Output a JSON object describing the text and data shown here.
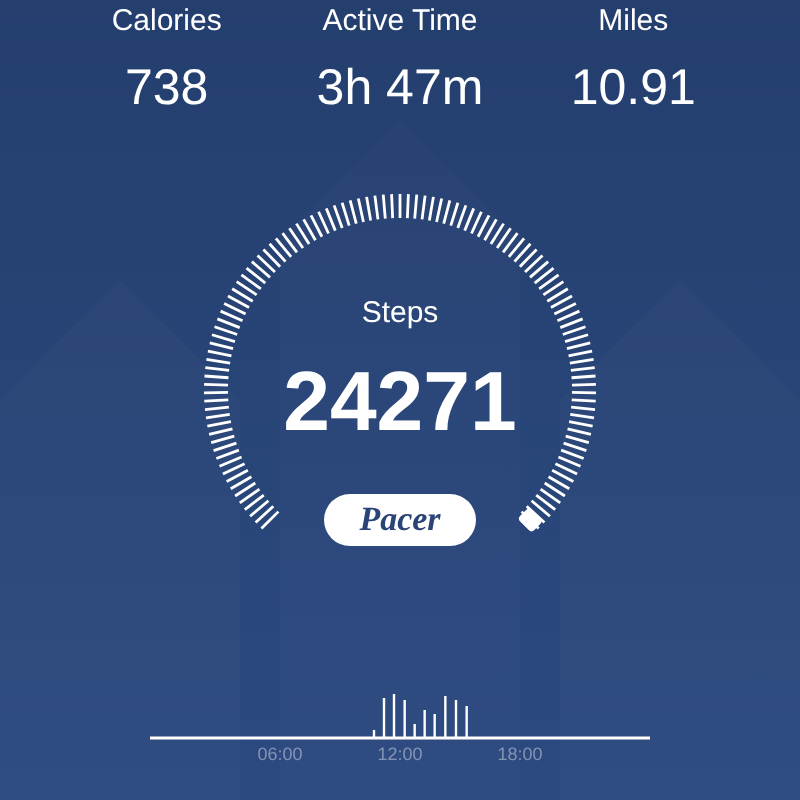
{
  "stats": [
    {
      "label": "Calories",
      "value": "738"
    },
    {
      "label": "Active Time",
      "value": "3h 47m"
    },
    {
      "label": "Miles",
      "value": "10.91"
    }
  ],
  "gauge": {
    "label": "Steps",
    "value": "24271"
  },
  "logo": "Pacer",
  "timeline": {
    "labels": [
      "06:00",
      "12:00",
      "18:00"
    ]
  }
}
